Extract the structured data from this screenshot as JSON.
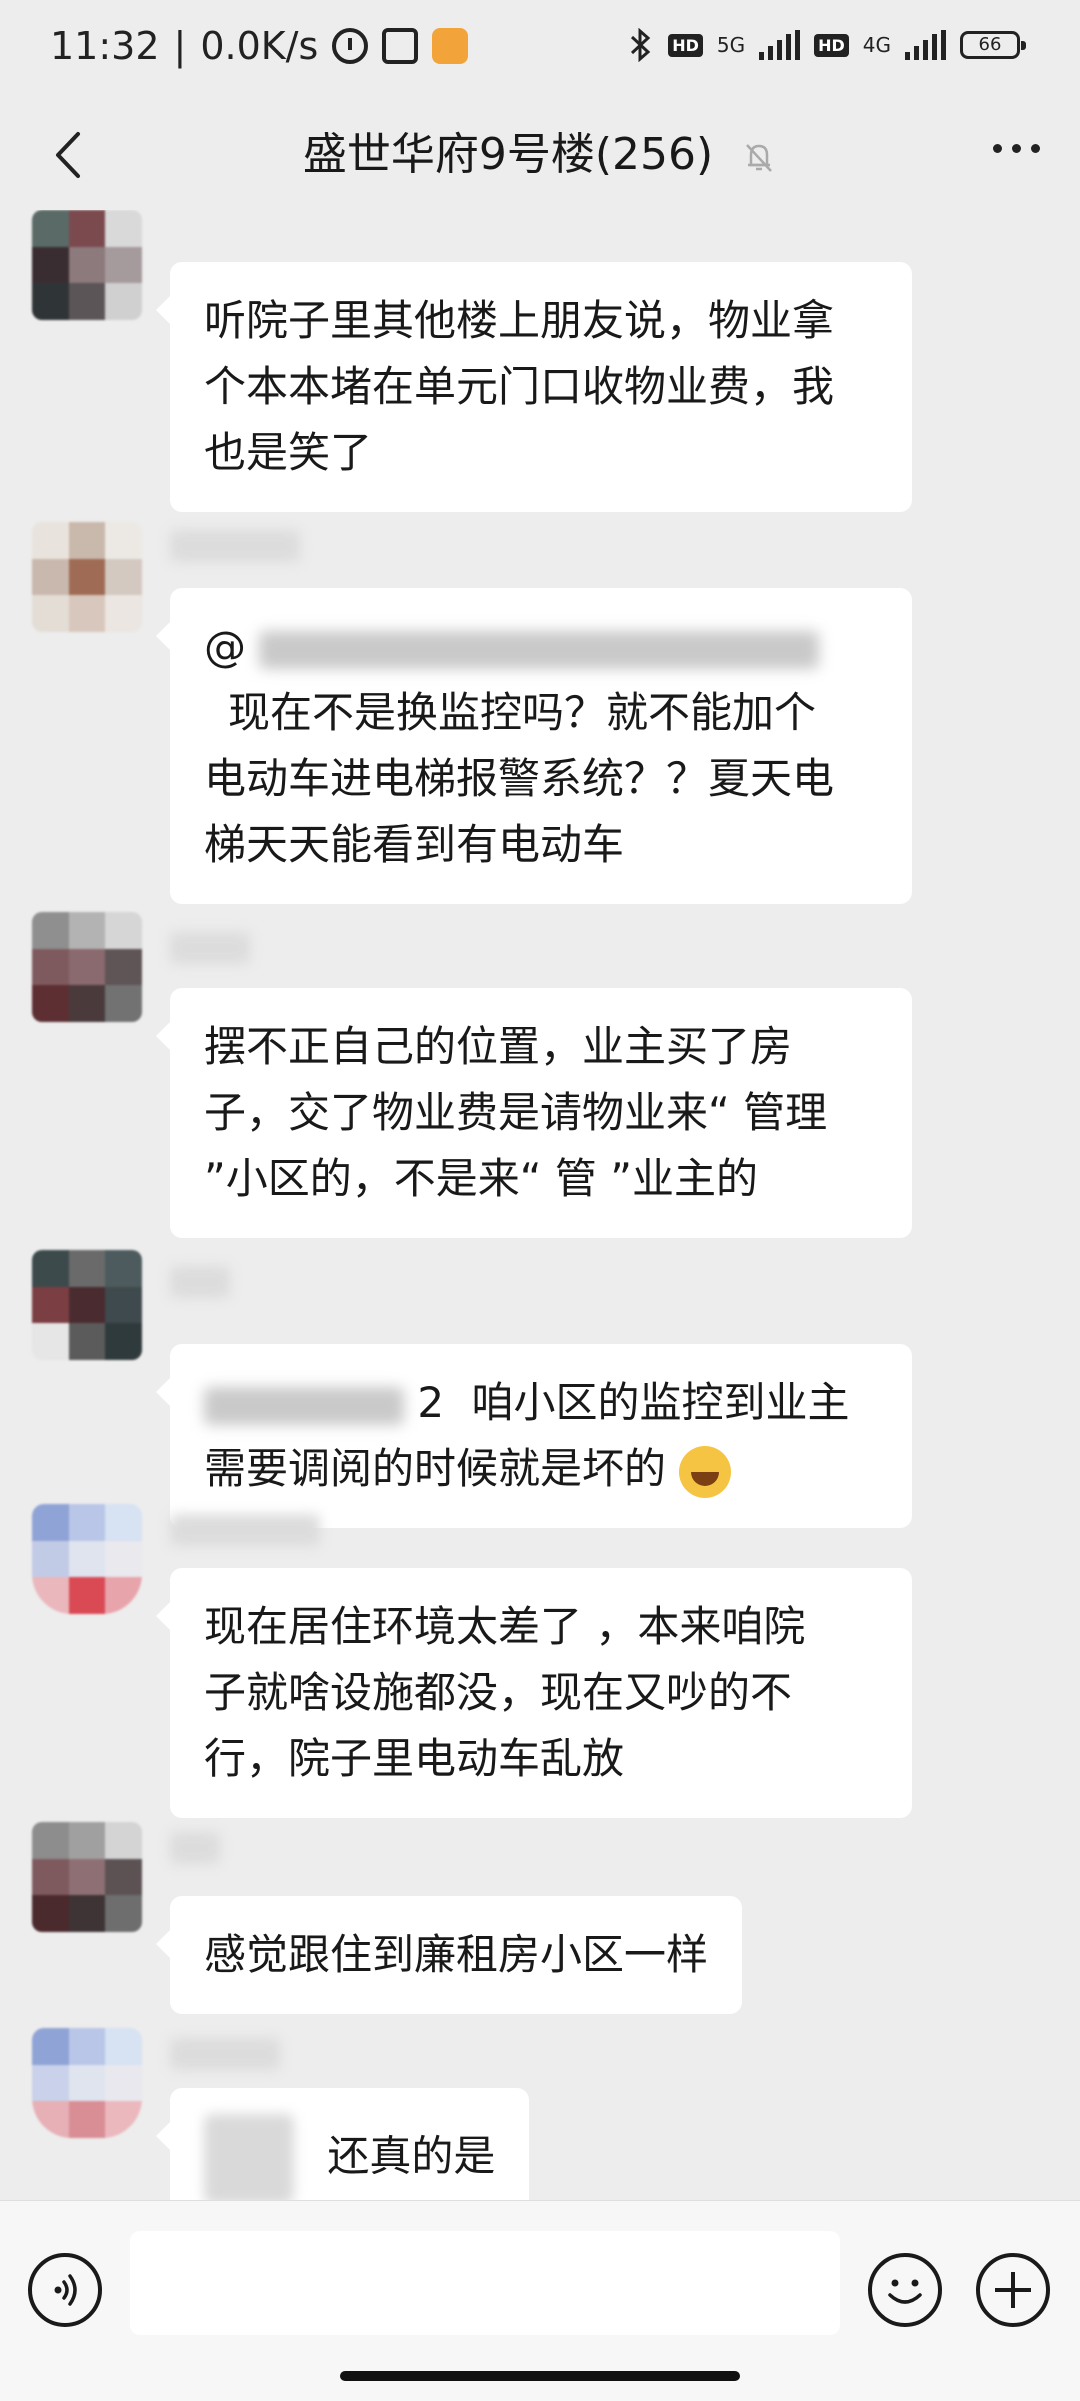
{
  "status_bar": {
    "time": "11:32",
    "speed": "0.0K/s",
    "net1": "5G",
    "net2": "4G",
    "hd": "HD",
    "battery": "66",
    "icons": [
      "alarm-icon",
      "nfc-icon",
      "app-notification-icon",
      "bluetooth-icon",
      "signal-icon",
      "battery-icon"
    ]
  },
  "header": {
    "title": "盛世华府9号楼(256)",
    "icons": [
      "back-arrow-icon",
      "muted-bell-icon",
      "more-icon"
    ]
  },
  "messages": [
    {
      "lines": [
        "听院子里其他楼上朋友说，物业拿",
        "个本本堵在单元门口收物业费，我",
        "也是笑了"
      ]
    },
    {
      "lines": [
        "现在不是换监控吗？就不能加个",
        "电动车进电梯报警系统？？夏天电",
        "梯天天能看到有电动车"
      ],
      "prefix": "@"
    },
    {
      "lines": [
        "摆不正自己的位置，业主买了房",
        "子，交了物业费是请物业来“ 管理",
        "”小区的，不是来“ 管 ”业主的"
      ]
    },
    {
      "lines": [
        "咱小区的监控到业主",
        "需要调阅的时候就是坏的"
      ],
      "prefix_tail": "2",
      "emoji": "sweat-laugh-emoji"
    },
    {
      "lines": [
        "现在居住环境太差了 ，本来咱院",
        "子就啥设施都没，现在又吵的不",
        "行，院子里电动车乱放"
      ]
    },
    {
      "lines": [
        "感觉跟住到廉租房小区一样"
      ]
    },
    {
      "lines": [
        "还真的是"
      ]
    }
  ],
  "colors": {
    "background": "#ededed",
    "bubble": "#ffffff",
    "text": "#191919"
  }
}
